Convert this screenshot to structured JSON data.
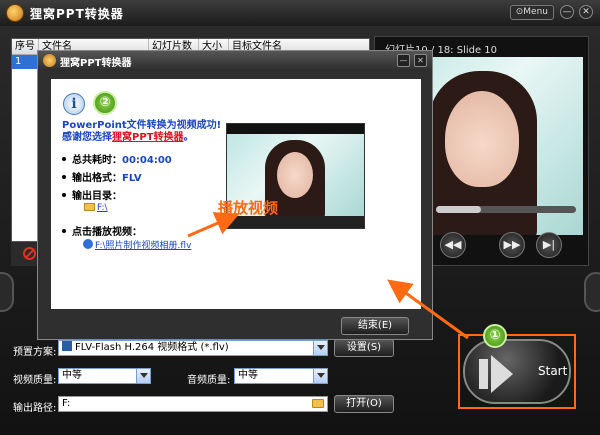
{
  "app": {
    "title": "狸窝PPT转换器",
    "menu_label": "Menu",
    "min_label": "—",
    "close_label": "✕"
  },
  "file_table": {
    "columns": [
      "序号",
      "文件名",
      "幻灯片数",
      "大小",
      "目标文件名"
    ],
    "rows": [
      {
        "index": "1"
      }
    ]
  },
  "preview": {
    "slide_info": "幻灯片10 / 18: Slide 10",
    "progress": 0.32,
    "prev_label": "◀◀",
    "next_label": "▶▶",
    "end_label": "▶|"
  },
  "settings": {
    "preset_label": "预置方案:",
    "preset_value": "FLV-Flash H.264 视频格式 (*.flv)",
    "settings_button": "设置(S)",
    "video_quality_label": "视频质量:",
    "video_quality_value": "中等",
    "audio_quality_label": "音频质量:",
    "audio_quality_value": "中等",
    "output_label": "输出路径:",
    "output_value": "F:",
    "open_button": "打开(O)"
  },
  "start": {
    "label": "Start",
    "badge": "①"
  },
  "dialog": {
    "title": "狸窝PPT转换器",
    "badge": "②",
    "info_glyph": "i",
    "success_line1": "PowerPoint文件转换为视频成功!",
    "success_line2_prefix": "感谢您选择",
    "success_line2_highlight": "狸窝PPT转换器",
    "success_line2_suffix": "。",
    "total_time_label": "总共耗时：",
    "total_time_value": "00:04:00",
    "format_label": "输出格式：",
    "format_value": "FLV",
    "output_dir_label": "输出目录：",
    "output_dir_value": "F:\\",
    "play_label": "点击播放视频：",
    "play_link": "F:\\照片制作视频相册.flv",
    "play_caption": "播放视频",
    "close_button": "结束(E)",
    "min_label": "—",
    "close_label": "✕"
  },
  "colors": {
    "accent_orange": "#ff6a12",
    "link_blue": "#1946c2",
    "highlight_red": "#dd1122"
  }
}
